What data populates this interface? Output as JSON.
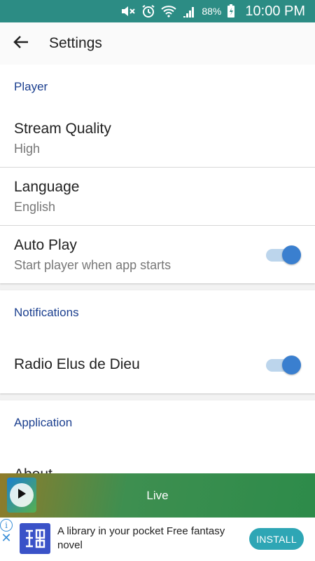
{
  "status_bar": {
    "battery": "88%",
    "time": "10:00 PM",
    "icons": [
      "mute-icon",
      "alarm-icon",
      "wifi-icon",
      "signal-icon",
      "battery-charging-icon"
    ]
  },
  "app_bar": {
    "back_icon": "arrow-left-icon",
    "title": "Settings"
  },
  "sections": {
    "player": {
      "title": "Player",
      "items": [
        {
          "title": "Stream Quality",
          "summary": "High"
        },
        {
          "title": "Language",
          "summary": "English"
        },
        {
          "title": "Auto Play",
          "summary": "Start player when app starts",
          "toggle_on": true
        }
      ]
    },
    "notifications": {
      "title": "Notifications",
      "items": [
        {
          "title": "Radio Elus de Dieu",
          "toggle_on": true
        }
      ]
    },
    "application": {
      "title": "Application",
      "items": [
        {
          "title": "About"
        }
      ]
    }
  },
  "mini_player": {
    "status": "Live",
    "play_icon": "play-icon"
  },
  "ad_banner": {
    "text": "A library in your pocket Free fantasy novel",
    "button": "INSTALL",
    "info_icon": "info-icon",
    "close_icon": "close-icon"
  },
  "colors": {
    "status_bar": "#2c8c84",
    "section_title": "#1b3f8f",
    "switch_thumb": "#3a7fcf",
    "switch_track": "#bcd5ec",
    "install_button": "#2ea6b5"
  }
}
